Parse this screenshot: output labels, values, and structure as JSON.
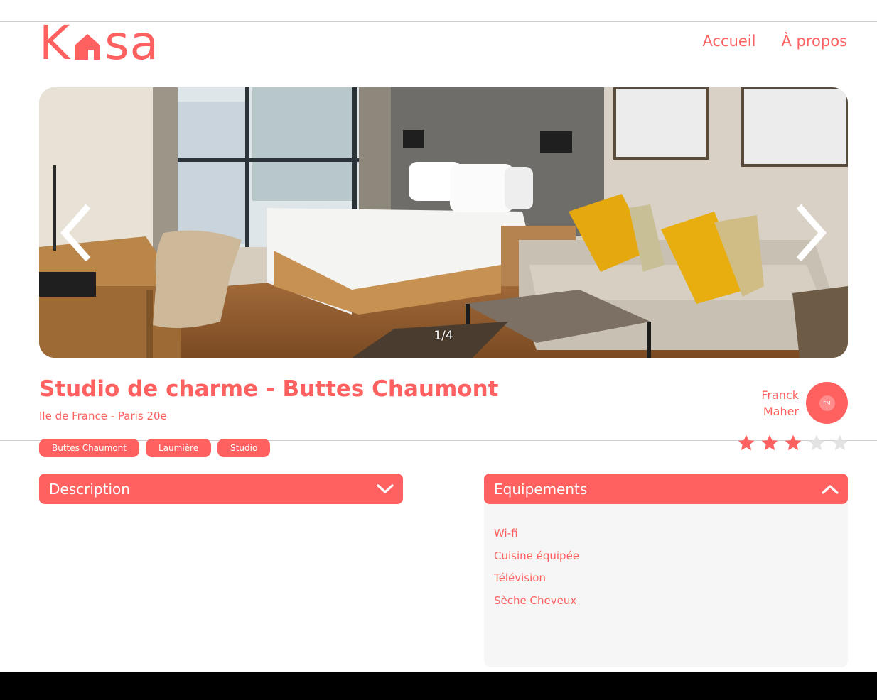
{
  "header": {
    "logo_letters": [
      "K",
      "sa"
    ],
    "nav": [
      {
        "label": "Accueil"
      },
      {
        "label": "À propos"
      }
    ]
  },
  "slideshow": {
    "counter": "1/4",
    "prev_icon": "chevron-left-icon",
    "next_icon": "chevron-right-icon"
  },
  "listing": {
    "title": "Studio de charme - Buttes Chaumont",
    "location": "Ile de France - Paris 20e",
    "tags": [
      "Buttes Chaumont",
      "Laumière",
      "Studio"
    ],
    "host": {
      "first_name": "Franck",
      "last_name": "Maher",
      "initials": "FM"
    },
    "rating": 3,
    "rating_max": 5
  },
  "collapses": {
    "description": {
      "label": "Description",
      "icon": "chevron-down-icon"
    },
    "equipments": {
      "label": "Equipements",
      "icon": "chevron-up-icon",
      "items": [
        "Wi-fi",
        "Cuisine équipée",
        "Télévision",
        "Sèche Cheveux"
      ]
    }
  },
  "colors": {
    "brand": "#FF6060",
    "star_empty": "#E3E3E3",
    "panel_bg": "#F6F6F6"
  }
}
